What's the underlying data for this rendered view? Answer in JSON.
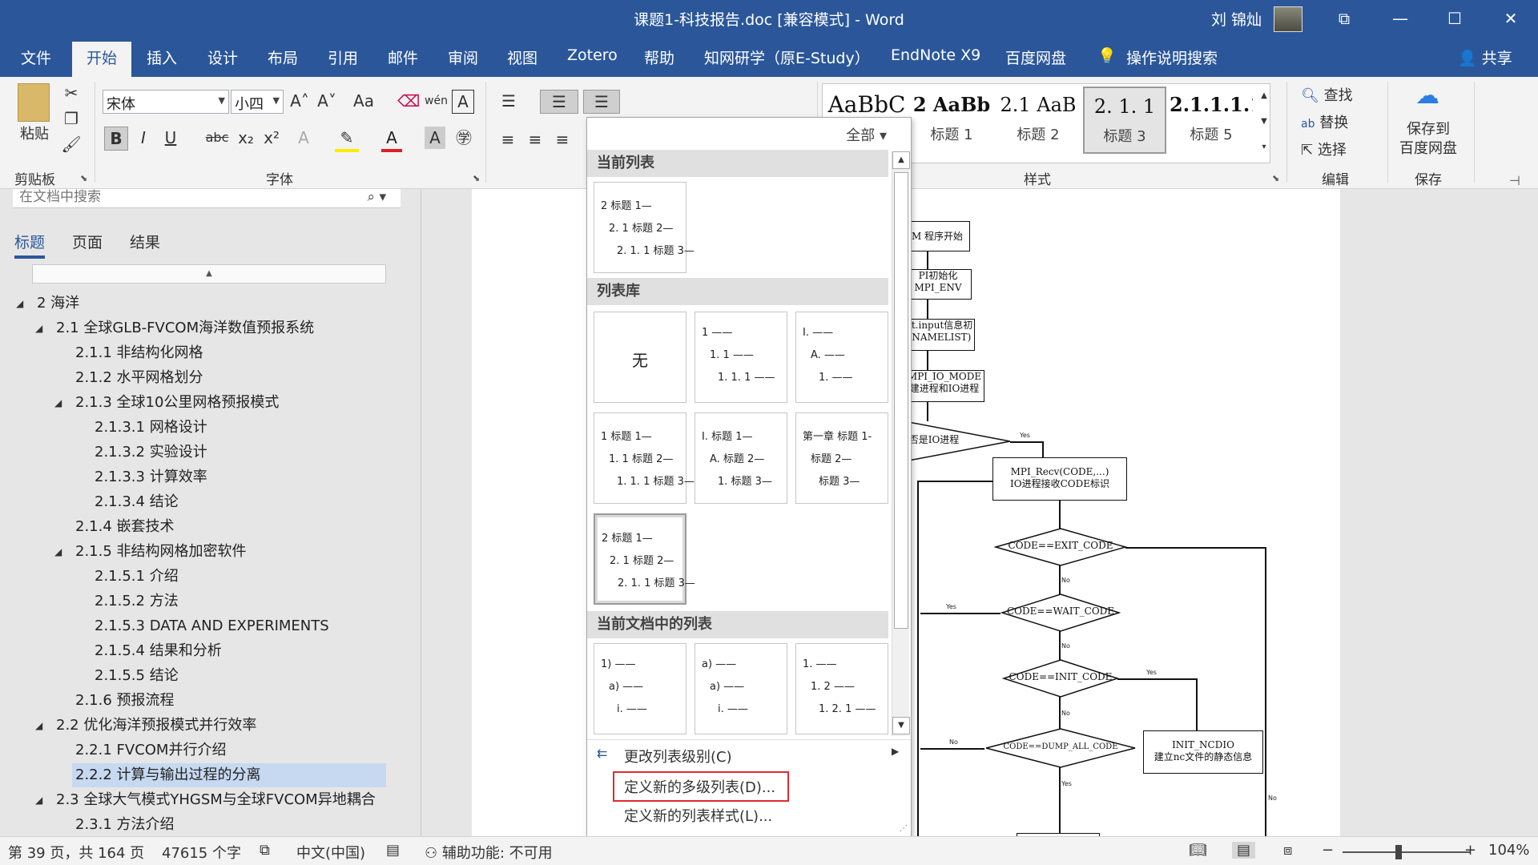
{
  "window": {
    "title": "课题1-科技报告.doc [兼容模式] - Word",
    "user": "刘 锦灿",
    "restore_symbol": "⧉",
    "minimize_symbol": "—",
    "maximize_symbol": "☐",
    "close_symbol": "✕"
  },
  "tabs": [
    "文件",
    "开始",
    "插入",
    "设计",
    "布局",
    "引用",
    "邮件",
    "审阅",
    "视图",
    "Zotero",
    "帮助",
    "知网研学（原E-Study）",
    "EndNote X9",
    "百度网盘"
  ],
  "active_tab": "开始",
  "tell_me": "操作说明搜索",
  "share": "共享",
  "ribbon": {
    "clipboard": {
      "paste": "粘贴",
      "label": "剪贴板"
    },
    "font": {
      "name": "宋体",
      "size": "小四",
      "label": "字体",
      "grow": "A˄",
      "shrink": "A˅",
      "case": "Aa",
      "bold": "B",
      "italic": "I",
      "underline": "U",
      "strike": "abc",
      "subscript": "x₂",
      "superscript": "x²"
    },
    "styles": {
      "label": "样式",
      "items": [
        {
          "preview": "AaBbC",
          "name": ""
        },
        {
          "preview": "2 AaBb",
          "name": "标题 1"
        },
        {
          "preview": "2.1 AaB",
          "name": "标题 2"
        },
        {
          "preview": "2. 1. 1",
          "name": "标题 3"
        },
        {
          "preview": "2.1.1.1.1",
          "name": "标题 5"
        }
      ]
    },
    "editing": {
      "find": "查找",
      "replace": "替换",
      "select": "选择",
      "label": "编辑"
    },
    "save": {
      "line1": "保存到",
      "line2": "百度网盘",
      "label": "保存"
    }
  },
  "nav": {
    "search_placeholder": "在文档中搜索",
    "tabs": [
      "标题",
      "页面",
      "结果"
    ],
    "scroll_up": "▲",
    "outline": [
      {
        "text": "2 海洋",
        "level": 0,
        "expanded": true
      },
      {
        "text": "2.1 全球GLB-FVCOM海洋数值预报系统",
        "level": 1,
        "expanded": true
      },
      {
        "text": "2.1.1 非结构化网格",
        "level": 2
      },
      {
        "text": "2.1.2 水平网格划分",
        "level": 2
      },
      {
        "text": "2.1.3 全球10公里网格预报模式",
        "level": 2,
        "expanded": true
      },
      {
        "text": "2.1.3.1 网格设计",
        "level": 3
      },
      {
        "text": "2.1.3.2 实验设计",
        "level": 3
      },
      {
        "text": "2.1.3.3 计算效率",
        "level": 3
      },
      {
        "text": "2.1.3.4 结论",
        "level": 3
      },
      {
        "text": "2.1.4 嵌套技术",
        "level": 2
      },
      {
        "text": "2.1.5 非结构网格加密软件",
        "level": 2,
        "expanded": true
      },
      {
        "text": "2.1.5.1 介绍",
        "level": 3
      },
      {
        "text": "2.1.5.2 方法",
        "level": 3
      },
      {
        "text": "2.1.5.3 DATA AND EXPERIMENTS",
        "level": 3
      },
      {
        "text": "2.1.5.4 结果和分析",
        "level": 3
      },
      {
        "text": "2.1.5.5 结论",
        "level": 3
      },
      {
        "text": "2.1.6 预报流程",
        "level": 2
      },
      {
        "text": "2.2 优化海洋预报模式并行效率",
        "level": 1,
        "expanded": true
      },
      {
        "text": "2.2.1 FVCOM并行介绍",
        "level": 2
      },
      {
        "text": "2.2.2 计算与输出过程的分离",
        "level": 2,
        "selected": true
      },
      {
        "text": "2.3 全球大气模式YHGSM与全球FVCOM异地耦合",
        "level": 1,
        "expanded": true
      },
      {
        "text": "2.3.1 方法介绍",
        "level": 2
      }
    ]
  },
  "dropdown": {
    "filter": "全部",
    "sections": {
      "current": "当前列表",
      "library": "列表库",
      "in_doc": "当前文档中的列表"
    },
    "none_label": "无",
    "current_list": [
      "2 标题 1—",
      "2. 1 标题 2—",
      "2. 1. 1 标题 3—"
    ],
    "library": [
      [
        "1 ——",
        "1. 1 ——",
        "1. 1. 1 ——"
      ],
      [
        "I. ——",
        "A. ——",
        "1. ——"
      ],
      [
        "1 标题 1—",
        "1. 1 标题 2—",
        "1. 1. 1 标题 3—"
      ],
      [
        "I. 标题 1—",
        "A. 标题 2—",
        "1. 标题 3—"
      ],
      [
        "第一章 标题 1-",
        "标题 2—",
        "标题 3—"
      ],
      [
        "2 标题 1—",
        "2. 1 标题 2—",
        "2. 1. 1 标题 3—"
      ]
    ],
    "in_doc": [
      [
        "1) ——",
        "a) ——",
        "i. ——"
      ],
      [
        "a) ——",
        "a) ——",
        "i. ——"
      ],
      [
        "1. ——",
        "1. 2 ——",
        "1. 2. 1 ——"
      ]
    ],
    "commands": {
      "change_level": "更改列表级别(C)",
      "define_multilevel": "定义新的多级列表(D)...",
      "define_style": "定义新的列表样式(L)..."
    }
  },
  "flowchart": {
    "start": "M 程序开始",
    "mpi_init_1": "PI初始化",
    "mpi_init_2": "MPI_ENV",
    "input_1": "st.input信息初",
    "input_2": "(NAMELIST)",
    "io_mode_1": "MPI_IO_MODE",
    "io_mode_2": "建进程和IO进程",
    "is_io": "否是IO进程",
    "recv_1": "MPI_Recv(CODE,...)",
    "recv_2": "IO进程接收CODE标识",
    "exit": "CODE==EXIT_CODE",
    "wait": "CODE==WAIT_CODE",
    "init": "CODE==INIT_CODE",
    "dump": "CODE==DUMP_ALL_CODE",
    "ncdio_1": "INIT_NCDIO",
    "ncdio_2": "建立nc文件的静态信息",
    "yes": "Yes",
    "no": "No"
  },
  "status": {
    "page": "第 39 页，共 164 页",
    "words": "47615 个字",
    "language": "中文(中国)",
    "accessibility": "辅助功能: 不可用",
    "zoom": "104%"
  },
  "colors": {
    "word_blue": "#2b579a",
    "highlight_red": "#e02b2b",
    "selected_nav": "#c7d9f1"
  }
}
